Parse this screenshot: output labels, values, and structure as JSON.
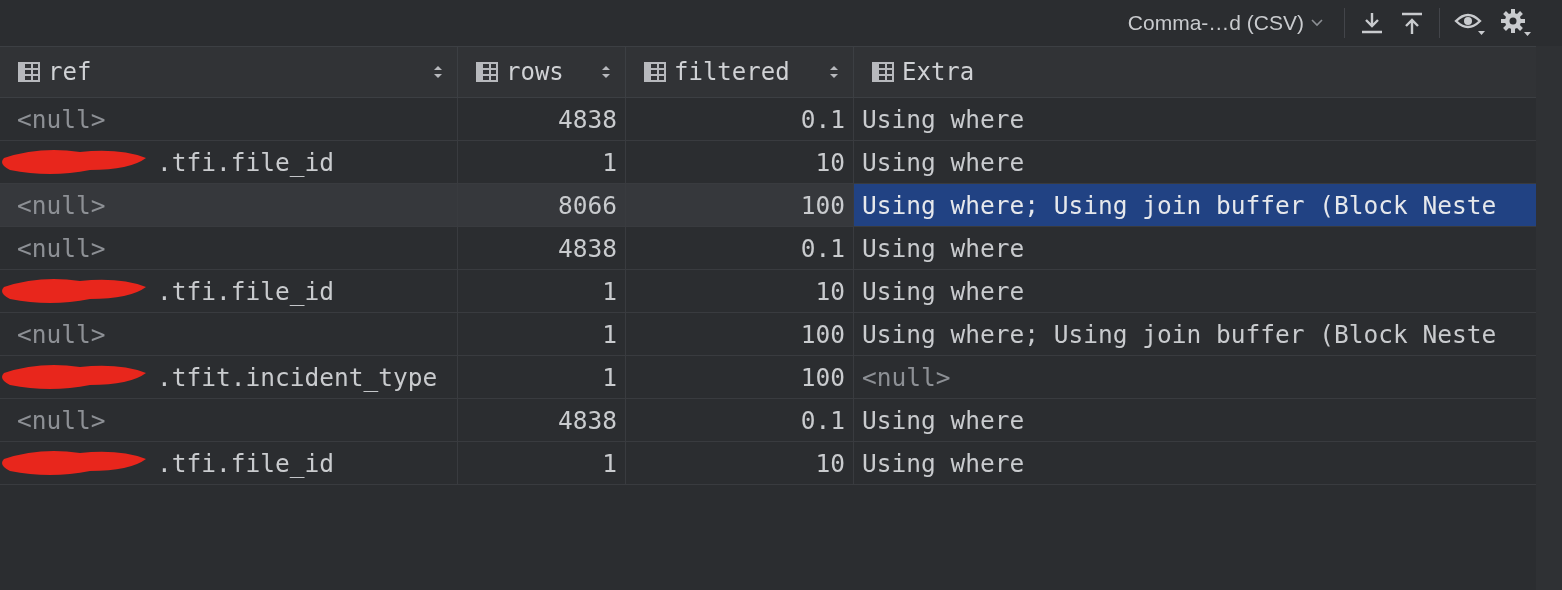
{
  "toolbar": {
    "format": "Comma-…d (CSV)"
  },
  "table": {
    "columns": [
      {
        "label": "ref",
        "sortable": true,
        "kind": "text"
      },
      {
        "label": "rows",
        "sortable": true,
        "kind": "number"
      },
      {
        "label": "filtered",
        "sortable": true,
        "kind": "number"
      },
      {
        "label": "Extra",
        "sortable": false,
        "kind": "text"
      }
    ],
    "rows": [
      {
        "selected": false,
        "cells": [
          {
            "text": "<null>",
            "null": true
          },
          {
            "text": "4838"
          },
          {
            "text": "0.1"
          },
          {
            "text": "Using where"
          }
        ]
      },
      {
        "selected": false,
        "cells": [
          {
            "text": ".tfi.file_id",
            "redacted": true
          },
          {
            "text": "1"
          },
          {
            "text": "10"
          },
          {
            "text": "Using where"
          }
        ]
      },
      {
        "selected": true,
        "cells": [
          {
            "text": "<null>",
            "null": true
          },
          {
            "text": "8066"
          },
          {
            "text": "100"
          },
          {
            "text": "Using where; Using join buffer (Block Neste",
            "selected": true
          }
        ]
      },
      {
        "selected": false,
        "cells": [
          {
            "text": "<null>",
            "null": true
          },
          {
            "text": "4838"
          },
          {
            "text": "0.1"
          },
          {
            "text": "Using where"
          }
        ]
      },
      {
        "selected": false,
        "cells": [
          {
            "text": ".tfi.file_id",
            "redacted": true
          },
          {
            "text": "1"
          },
          {
            "text": "10"
          },
          {
            "text": "Using where"
          }
        ]
      },
      {
        "selected": false,
        "cells": [
          {
            "text": "<null>",
            "null": true
          },
          {
            "text": "1"
          },
          {
            "text": "100"
          },
          {
            "text": "Using where; Using join buffer (Block Neste"
          }
        ]
      },
      {
        "selected": false,
        "cells": [
          {
            "text": ".tfit.incident_type",
            "redacted": true
          },
          {
            "text": "1"
          },
          {
            "text": "100"
          },
          {
            "text": "<null>",
            "null": true
          }
        ]
      },
      {
        "selected": false,
        "cells": [
          {
            "text": "<null>",
            "null": true
          },
          {
            "text": "4838"
          },
          {
            "text": "0.1"
          },
          {
            "text": "Using where"
          }
        ]
      },
      {
        "selected": false,
        "cells": [
          {
            "text": ".tfi.file_id",
            "redacted": true
          },
          {
            "text": "1"
          },
          {
            "text": "10"
          },
          {
            "text": "Using where"
          }
        ]
      }
    ]
  }
}
